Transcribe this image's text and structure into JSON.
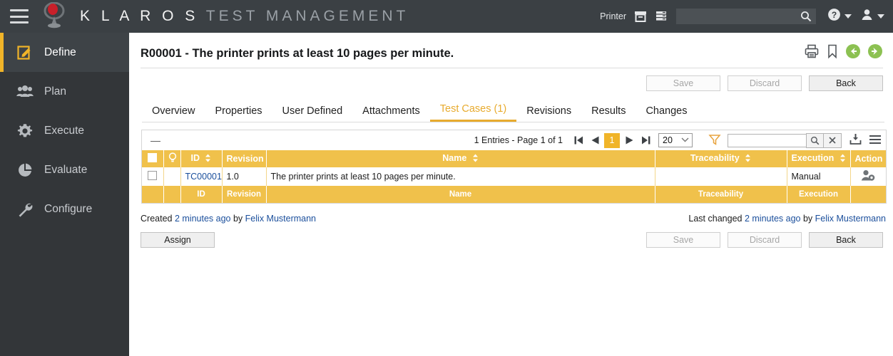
{
  "app": {
    "brand_primary": "K L A R O S",
    "brand_secondary": "TEST MANAGEMENT",
    "accent_color": "#f0b429",
    "header_bg": "#3b4044",
    "sidebar_bg": "#333639"
  },
  "header": {
    "menu_icon": "hamburger-icon",
    "logo_icon": "klaros-logo",
    "context_label": "Printer",
    "icons": [
      "archive-box-icon",
      "database-icon"
    ],
    "search_value": "",
    "search_placeholder": "",
    "search_icon": "search-icon",
    "help_icon": "help-icon",
    "user_icon": "user-icon"
  },
  "sidebar": {
    "items": [
      {
        "label": "Define",
        "icon": "edit-document-icon",
        "active": true
      },
      {
        "label": "Plan",
        "icon": "people-icon",
        "active": false
      },
      {
        "label": "Execute",
        "icon": "gear-icon",
        "active": false
      },
      {
        "label": "Evaluate",
        "icon": "pie-chart-icon",
        "active": false
      },
      {
        "label": "Configure",
        "icon": "wrench-icon",
        "active": false
      }
    ]
  },
  "page": {
    "title": "R00001 - The printer prints at least 10 pages per minute.",
    "head_icons": [
      "print-icon",
      "bookmark-icon",
      "previous-arrow-icon",
      "next-arrow-icon"
    ]
  },
  "top_buttons": [
    {
      "label": "Save",
      "enabled": false
    },
    {
      "label": "Discard",
      "enabled": false
    },
    {
      "label": "Back",
      "enabled": true
    }
  ],
  "tabs": [
    {
      "label": "Overview",
      "active": false
    },
    {
      "label": "Properties",
      "active": false
    },
    {
      "label": "User Defined",
      "active": false
    },
    {
      "label": "Attachments",
      "active": false
    },
    {
      "label": "Test Cases (1)",
      "active": true
    },
    {
      "label": "Revisions",
      "active": false
    },
    {
      "label": "Results",
      "active": false
    },
    {
      "label": "Changes",
      "active": false
    }
  ],
  "table_toolbar": {
    "collapse_label": "—",
    "entries_text": "1 Entries - Page 1 of 1",
    "first_icon": "first-page-icon",
    "prev_icon": "previous-page-icon",
    "current_page": "1",
    "next_icon": "next-page-icon",
    "last_icon": "last-page-icon",
    "page_size": "20",
    "filter_icon": "filter-funnel-icon",
    "filter_value": "",
    "search_icon": "search-icon",
    "clear_icon": "clear-x-icon",
    "export_icon": "export-download-icon",
    "menu_icon": "list-menu-icon"
  },
  "table": {
    "columns": [
      {
        "key": "select",
        "label": "",
        "sortable": false,
        "align": "center"
      },
      {
        "key": "bulb",
        "label": "",
        "sortable": false,
        "align": "center"
      },
      {
        "key": "id",
        "label": "ID",
        "sortable": true,
        "align": "center"
      },
      {
        "key": "revision",
        "label": "Revision",
        "sortable": false,
        "align": "center"
      },
      {
        "key": "name",
        "label": "Name",
        "sortable": true,
        "align": "center"
      },
      {
        "key": "traceability",
        "label": "Traceability",
        "sortable": true,
        "align": "center"
      },
      {
        "key": "execution",
        "label": "Execution",
        "sortable": true,
        "align": "center"
      },
      {
        "key": "action",
        "label": "Action",
        "sortable": false,
        "align": "center"
      }
    ],
    "footer_labels": [
      "",
      "",
      "ID",
      "Revision",
      "Name",
      "Traceability",
      "Execution",
      ""
    ],
    "rows": [
      {
        "id": "TC00001",
        "revision": "1.0",
        "name": "The printer prints at least 10 pages per minute.",
        "traceability": "",
        "execution": "Manual",
        "action_icon": "assign-user-icon"
      }
    ]
  },
  "meta": {
    "created_prefix": "Created",
    "created_time": "2 minutes ago",
    "created_by_prefix": "by",
    "created_by": "Felix Mustermann",
    "changed_prefix": "Last changed",
    "changed_time": "2 minutes ago",
    "changed_by_prefix": "by",
    "changed_by": "Felix Mustermann"
  },
  "bottom": {
    "assign_label": "Assign",
    "buttons": [
      {
        "label": "Save",
        "enabled": false
      },
      {
        "label": "Discard",
        "enabled": false
      },
      {
        "label": "Back",
        "enabled": true
      }
    ]
  }
}
